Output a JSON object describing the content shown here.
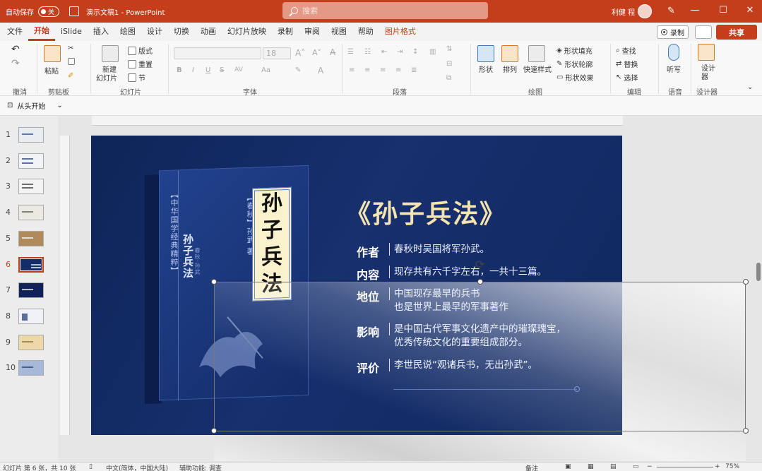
{
  "titlebar": {
    "autosave_label": "自动保存",
    "autosave_state": "关",
    "doc_title": "演示文稿1 - PowerPoint",
    "search_placeholder": "搜索",
    "user_name": "利健 程",
    "min_glyph": "—",
    "max_glyph": "☐",
    "close_glyph": "✕",
    "brand_color": "#c43e1c"
  },
  "menu": {
    "tabs": [
      "文件",
      "开始",
      "iSlide",
      "插入",
      "绘图",
      "设计",
      "切换",
      "动画",
      "幻灯片放映",
      "录制",
      "审阅",
      "视图",
      "帮助",
      "图片格式"
    ],
    "active": "开始",
    "record_label": "录制",
    "share_label": "共享"
  },
  "ribbon": {
    "undo_group": "撤消",
    "clipboard_group": "剪贴板",
    "paste_label": "粘贴",
    "slides_group": "幻灯片",
    "new_slide_label": "新建",
    "new_slide_label2": "幻灯片",
    "layout_label": "版式",
    "reset_label": "重置",
    "section_label": "节",
    "font_group": "字体",
    "font_size": "18",
    "bold": "B",
    "italic": "I",
    "underline": "U",
    "strike": "S",
    "spacing": "AV",
    "paragraph_group": "段落",
    "drawing_group": "绘图",
    "shape_label": "形状",
    "arrange_label": "排列",
    "quick_style_label": "快速样式",
    "shape_fill": "形状填充",
    "shape_outline": "形状轮廓",
    "shape_effect": "形状效果",
    "editing_group": "编辑",
    "find_label": "查找",
    "replace_label": "替换",
    "select_label": "选择",
    "voice_group": "语音",
    "dictate_label": "听写",
    "designer_group": "设计器",
    "designer_label": "设计",
    "designer_label2": "器"
  },
  "quickbar": {
    "from_start": "从头开始"
  },
  "thumbnails": {
    "numbers": [
      "1",
      "2",
      "3",
      "4",
      "5",
      "6",
      "7",
      "8",
      "9",
      "10"
    ],
    "active_index": 6
  },
  "slide": {
    "title": "《孙子兵法》",
    "book_title": [
      "孙",
      "子",
      "兵",
      "法"
    ],
    "book_series": "【中华国学经典精粹】",
    "book_author": "【春秋】孙武 著",
    "book_big": "孙子兵法",
    "book_sub": "春秋·孙武",
    "rows": [
      {
        "key": "作者",
        "values": [
          "春秋时吴国将军孙武。"
        ]
      },
      {
        "key": "内容",
        "values": [
          "现存共有六千字左右，一共十三篇。"
        ]
      },
      {
        "key": "地位",
        "values": [
          "中国现存最早的兵书",
          "也是世界上最早的军事著作"
        ]
      },
      {
        "key": "影响",
        "values": [
          "是中国古代军事文化遗产中的璀璨瑰宝，",
          "优秀传统文化的重要组成部分。"
        ]
      },
      {
        "key": "评价",
        "values": [
          "李世民说“观诸兵书，无出孙武”。"
        ]
      }
    ]
  },
  "statusbar": {
    "slide_info": "幻灯片 第 6 张，共 10 张",
    "language": "中文(简体，中国大陆)",
    "accessibility": "辅助功能: 调查",
    "notes": "备注",
    "zoom": "75%"
  }
}
